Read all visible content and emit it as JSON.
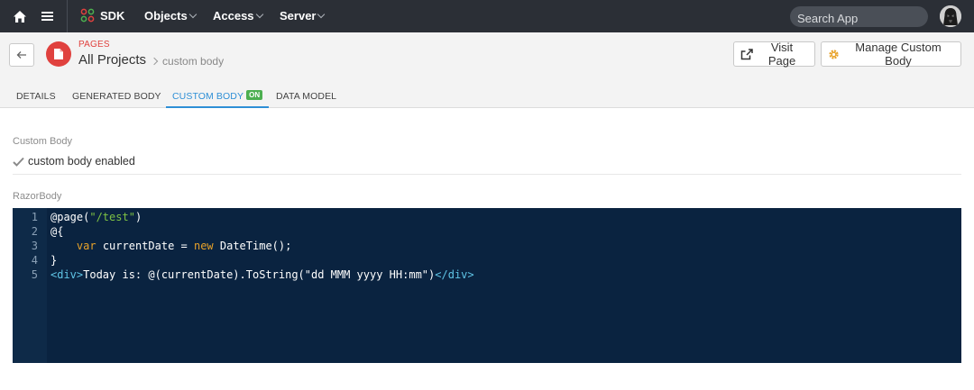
{
  "nav": {
    "brand_label": "SDK",
    "menus": [
      "Objects",
      "Access",
      "Server"
    ],
    "search_placeholder": "Search App"
  },
  "header": {
    "section_label": "PAGES",
    "breadcrumb_main": "All Projects",
    "breadcrumb_sub": "custom body",
    "visit_label": "Visit Page",
    "manage_label": "Manage Custom Body"
  },
  "tabs": {
    "items": [
      "DETAILS",
      "GENERATED BODY",
      "CUSTOM BODY",
      "DATA MODEL"
    ],
    "active_index": 2,
    "active_badge": "ON"
  },
  "custom_body": {
    "label": "Custom Body",
    "status": "custom body enabled"
  },
  "razor": {
    "label": "RazorBody",
    "line_numbers": [
      "1",
      "2",
      "3",
      "4",
      "5"
    ],
    "lines": [
      "@page(\"/test\")",
      "@{",
      "    var currentDate = new DateTime();",
      "}",
      "<div>Today is: @(currentDate).ToString(\"dd MMM yyyy HH:mm\")</div>"
    ],
    "l1_a": "@page(",
    "l1_b": "\"/test\"",
    "l1_c": ")",
    "l2": "@{",
    "l3_a": "    ",
    "l3_b": "var",
    "l3_c": " currentDate = ",
    "l3_d": "new",
    "l3_e": " DateTime();",
    "l4": "}",
    "l5_a": "<div>",
    "l5_b": "Today is: @(currentDate).ToString(\"dd MMM yyyy HH:mm\")",
    "l5_c": "</div>"
  },
  "colors": {
    "nav_bg": "#2b2f36",
    "accent_red": "#e0413e",
    "active_tab": "#2e8fd6",
    "badge_green": "#4caf50",
    "editor_bg": "#0a2340"
  }
}
